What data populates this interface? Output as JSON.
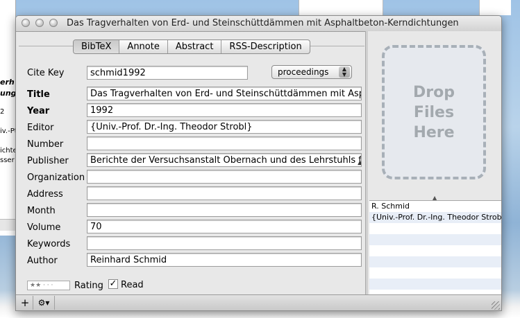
{
  "window": {
    "title": "Das Tragverhalten von Erd- und Steinschüttdämmen mit Asphaltbeton-Kerndichtungen"
  },
  "tabs": [
    {
      "label": "BibTeX",
      "selected": true
    },
    {
      "label": "Annote",
      "selected": false
    },
    {
      "label": "Abstract",
      "selected": false
    },
    {
      "label": "RSS-Description",
      "selected": false
    }
  ],
  "cite_key": {
    "label": "Cite Key",
    "value": "schmid1992"
  },
  "type_popup": {
    "value": "proceedings"
  },
  "fields": [
    {
      "label": "Title",
      "value": "Das Tragverhalten von Erd- und Steinschüttdämmen mit Asph",
      "bold": true
    },
    {
      "label": "Year",
      "value": "1992",
      "bold": true
    },
    {
      "label": "Editor",
      "value": "{Univ.-Prof. Dr.-Ing. Theodor Strobl}",
      "bold": false
    },
    {
      "label": "Number",
      "value": "",
      "bold": false
    },
    {
      "label": "Publisher",
      "value": "Berichte der Versuchsanstalt Obernach und des Lehrstuhls für",
      "bold": false
    },
    {
      "label": "Organization",
      "value": "",
      "bold": false
    },
    {
      "label": "Address",
      "value": "",
      "bold": false
    },
    {
      "label": "Month",
      "value": "",
      "bold": false
    },
    {
      "label": "Volume",
      "value": "70",
      "bold": false
    },
    {
      "label": "Keywords",
      "value": "",
      "bold": false
    },
    {
      "label": "Author",
      "value": "Reinhard Schmid",
      "bold": false
    }
  ],
  "drop_zone": {
    "line1": "Drop",
    "line2": "Files",
    "line3": "Here"
  },
  "persons_list": [
    "R. Schmid",
    "{Univ.-Prof. Dr.-Ing. Theodor Strobl"
  ],
  "rating": {
    "label": "Rating",
    "stars": "★★ · · ·",
    "value": 2,
    "max": 5
  },
  "read": {
    "label": "Read",
    "checked": true,
    "mark": "✓"
  },
  "bottom_bar": {
    "add": "+",
    "action": "⚙▾"
  },
  "background_window": {
    "lines": [
      "erh",
      "ung",
      "2",
      "iv.-Pt",
      "ichte",
      "sser"
    ]
  }
}
